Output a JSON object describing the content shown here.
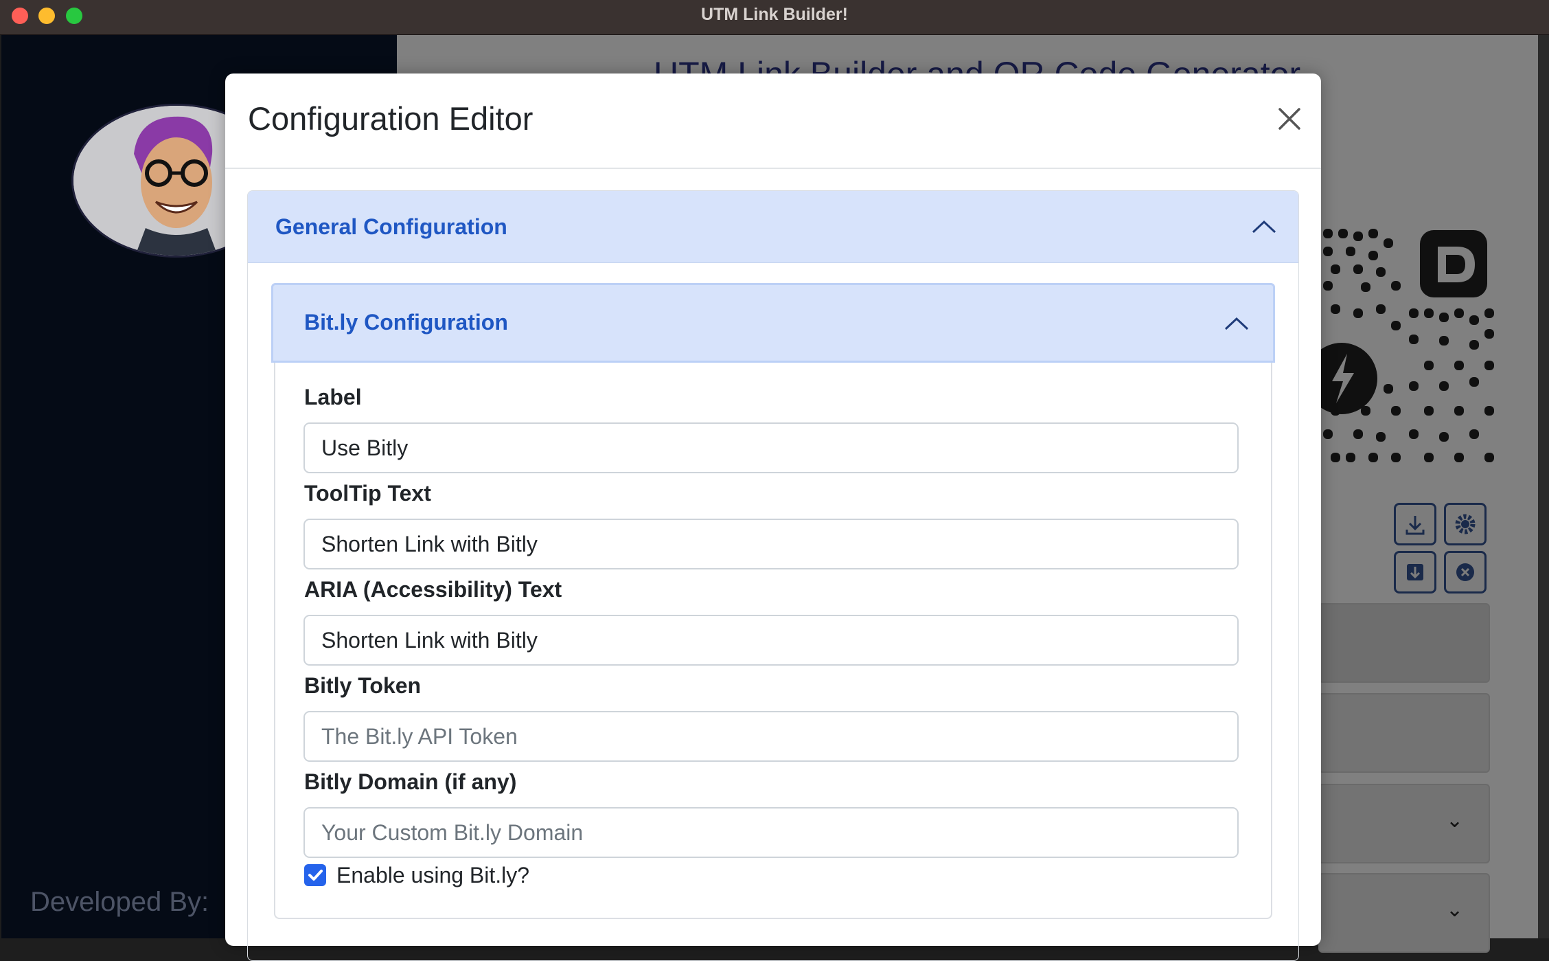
{
  "window": {
    "title": "UTM Link Builder!"
  },
  "background": {
    "heading": "UTM Link Builder and QR Code Generator",
    "developed_by": "Developed By:"
  },
  "modal": {
    "title": "Configuration Editor",
    "outer_section": {
      "title": "General Configuration",
      "expanded": true
    },
    "inner_section": {
      "title": "Bit.ly Configuration",
      "expanded": true
    },
    "fields": [
      {
        "label": "Label",
        "value": "Use Bitly",
        "placeholder": ""
      },
      {
        "label": "ToolTip Text",
        "value": "Shorten Link with Bitly",
        "placeholder": ""
      },
      {
        "label": "ARIA (Accessibility) Text",
        "value": "Shorten Link with Bitly",
        "placeholder": ""
      },
      {
        "label": "Bitly Token",
        "value": "",
        "placeholder": "The Bit.ly API Token"
      },
      {
        "label": "Bitly Domain (if any)",
        "value": "",
        "placeholder": "Your Custom Bit.ly Domain"
      }
    ],
    "enable_checkbox": {
      "label": "Enable using Bit.ly?",
      "checked": true
    }
  },
  "colors": {
    "accent": "#1f57c3",
    "accordion_header": "#d7e3fb",
    "checkbox": "#2563eb",
    "sidebar": "#050b16"
  },
  "icons": [
    "close-icon",
    "chevron-up-icon",
    "check-icon",
    "download-icon",
    "gear-icon",
    "save-icon",
    "clear-icon",
    "bolt-icon"
  ]
}
